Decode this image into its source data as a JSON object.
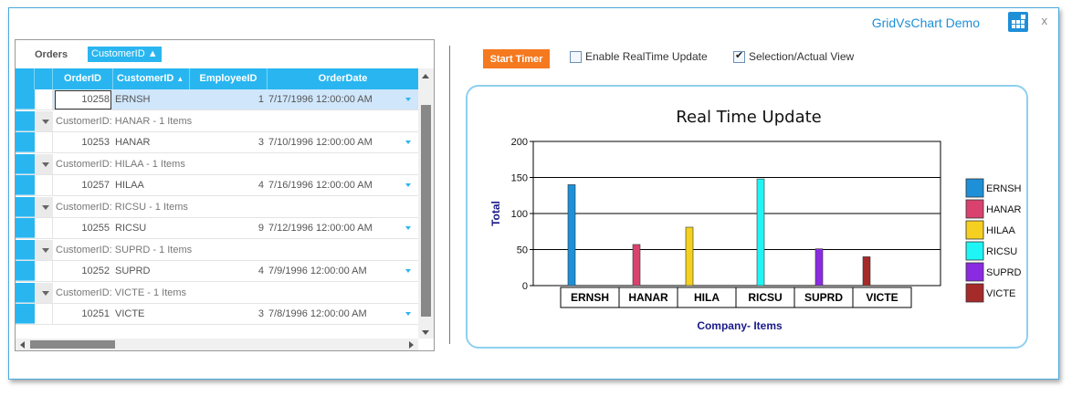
{
  "window": {
    "title": "GridVsChart Demo",
    "icon": "grid-icon",
    "close_label": "x"
  },
  "grid": {
    "group_panel": {
      "label": "Orders",
      "chip_label": "CustomerID",
      "chip_icon": "sort-ascending-icon"
    },
    "columns": [
      "OrderID",
      "CustomerID",
      "EmployeeID",
      "OrderDate"
    ],
    "sort_column": "CustomerID",
    "rows": [
      {
        "type": "data",
        "order_id": "10258",
        "customer_id": "ERNSH",
        "employee_id": "1",
        "order_date": "7/17/1996 12:00:00 AM",
        "selected": true
      },
      {
        "type": "group",
        "caption": "CustomerID: HANAR - 1 Items"
      },
      {
        "type": "data",
        "order_id": "10253",
        "customer_id": "HANAR",
        "employee_id": "3",
        "order_date": "7/10/1996 12:00:00 AM"
      },
      {
        "type": "group",
        "caption": "CustomerID: HILAA - 1 Items"
      },
      {
        "type": "data",
        "order_id": "10257",
        "customer_id": "HILAA",
        "employee_id": "4",
        "order_date": "7/16/1996 12:00:00 AM"
      },
      {
        "type": "group",
        "caption": "CustomerID: RICSU - 1 Items"
      },
      {
        "type": "data",
        "order_id": "10255",
        "customer_id": "RICSU",
        "employee_id": "9",
        "order_date": "7/12/1996 12:00:00 AM"
      },
      {
        "type": "group",
        "caption": "CustomerID: SUPRD - 1 Items"
      },
      {
        "type": "data",
        "order_id": "10252",
        "customer_id": "SUPRD",
        "employee_id": "4",
        "order_date": "7/9/1996 12:00:00 AM"
      },
      {
        "type": "group",
        "caption": "CustomerID: VICTE - 1 Items"
      },
      {
        "type": "data",
        "order_id": "10251",
        "customer_id": "VICTE",
        "employee_id": "3",
        "order_date": "7/8/1996 12:00:00 AM"
      }
    ]
  },
  "toolbar": {
    "start_timer_label": "Start Timer",
    "start_timer_color": "#f5791f",
    "realtime_label": "Enable RealTime Update",
    "realtime_checked": false,
    "selection_label": "Selection/Actual View",
    "selection_checked": true
  },
  "chart_data": {
    "type": "bar",
    "title": "Real Time Update",
    "xlabel": "Company- Items",
    "ylabel": "Total",
    "ylim": [
      0,
      200
    ],
    "yticks": [
      0,
      50,
      100,
      150,
      200
    ],
    "grid": true,
    "legend_position": "right",
    "categories": [
      "ERNSH",
      "HANAR",
      "HILA",
      "RICSU",
      "SUPRD",
      "VICTE"
    ],
    "series": [
      {
        "name": "ERNSH",
        "values": [
          140,
          null,
          null,
          null,
          null,
          null
        ],
        "color": "#1e90d8"
      },
      {
        "name": "HANAR",
        "values": [
          null,
          57,
          null,
          null,
          null,
          null
        ],
        "color": "#d9426f"
      },
      {
        "name": "HILAA",
        "values": [
          null,
          null,
          81,
          null,
          null,
          null
        ],
        "color": "#f5d020"
      },
      {
        "name": "RICSU",
        "values": [
          null,
          null,
          null,
          148,
          null,
          null
        ],
        "color": "#1ff5f5"
      },
      {
        "name": "SUPRD",
        "values": [
          null,
          null,
          null,
          null,
          51,
          null
        ],
        "color": "#8a2be2"
      },
      {
        "name": "VICTE",
        "values": [
          null,
          null,
          null,
          null,
          null,
          40
        ],
        "color": "#a52a2a"
      }
    ]
  }
}
